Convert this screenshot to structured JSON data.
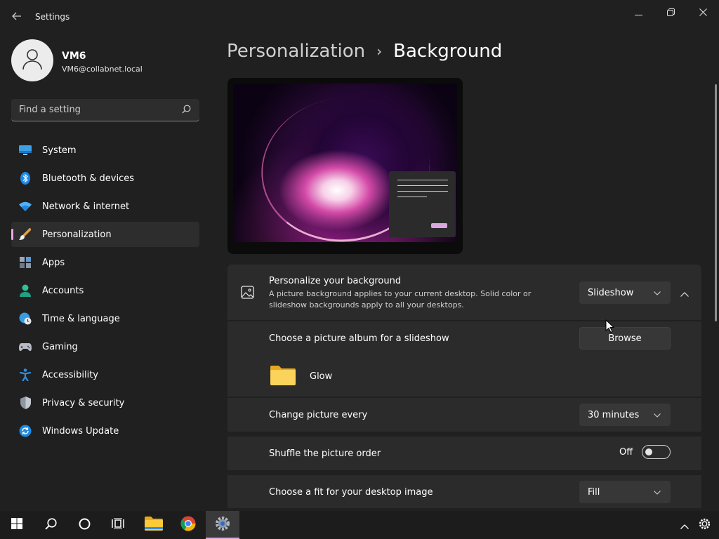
{
  "window": {
    "title": "Settings",
    "icons": {
      "back": "back-arrow-icon",
      "minimize": "minimize-icon",
      "maximize": "restore-icon",
      "close": "close-icon"
    }
  },
  "user": {
    "name": "VM6",
    "email": "VM6@collabnet.local"
  },
  "search": {
    "placeholder": "Find a setting",
    "value": ""
  },
  "sidebar": {
    "items": [
      {
        "label": "System",
        "icon": "monitor-icon",
        "active": false
      },
      {
        "label": "Bluetooth & devices",
        "icon": "bluetooth-icon",
        "active": false
      },
      {
        "label": "Network & internet",
        "icon": "wifi-icon",
        "active": false
      },
      {
        "label": "Personalization",
        "icon": "paintbrush-icon",
        "active": true
      },
      {
        "label": "Apps",
        "icon": "apps-grid-icon",
        "active": false
      },
      {
        "label": "Accounts",
        "icon": "person-icon",
        "active": false
      },
      {
        "label": "Time & language",
        "icon": "globe-clock-icon",
        "active": false
      },
      {
        "label": "Gaming",
        "icon": "gamepad-icon",
        "active": false
      },
      {
        "label": "Accessibility",
        "icon": "accessibility-icon",
        "active": false
      },
      {
        "label": "Privacy & security",
        "icon": "shield-icon",
        "active": false
      },
      {
        "label": "Windows Update",
        "icon": "update-icon",
        "active": false
      }
    ]
  },
  "main": {
    "breadcrumb": {
      "parent": "Personalization",
      "separator": "›",
      "current": "Background"
    },
    "background": {
      "title": "Personalize your background",
      "description": "A picture background applies to your current desktop. Solid color or slideshow backgrounds apply to all your desktops.",
      "selected": "Slideshow"
    },
    "album": {
      "label": "Choose a picture album for a slideshow",
      "button": "Browse",
      "folder_name": "Glow"
    },
    "interval": {
      "label": "Change picture every",
      "selected": "30 minutes"
    },
    "shuffle": {
      "label": "Shuffle the picture order",
      "state_label": "Off",
      "on": false
    },
    "fit": {
      "label": "Choose a fit for your desktop image",
      "selected": "Fill"
    }
  },
  "taskbar": {
    "apps": [
      "windows-start-icon",
      "search-icon",
      "cortana-icon",
      "task-view-icon",
      "file-explorer-icon",
      "chrome-icon",
      "settings-icon"
    ],
    "active_app": "settings-icon",
    "tray": [
      "show-hidden-icons-chevron-icon",
      "settings-gear-icon"
    ]
  },
  "colors": {
    "accent": "#d9a7e0",
    "background": "#202020",
    "card": "#2b2b2b"
  }
}
